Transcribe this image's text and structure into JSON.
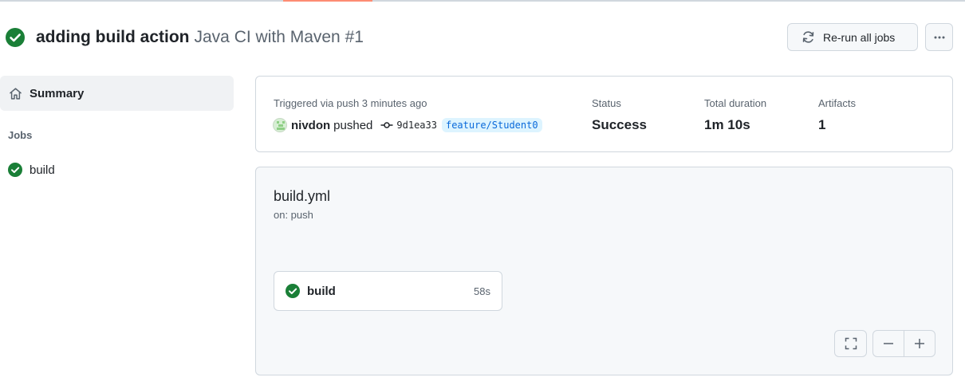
{
  "run": {
    "title": "adding build action",
    "workflow_label": "Java CI with Maven #1",
    "status_icon": "check-circle-fill-icon"
  },
  "actions": {
    "rerun_label": "Re-run all jobs",
    "rerun_icon": "sync-icon",
    "more_icon": "kebab-horizontal-icon"
  },
  "sidebar": {
    "summary_label": "Summary",
    "summary_icon": "home-icon",
    "jobs_heading": "Jobs",
    "jobs": [
      {
        "label": "build",
        "status": "success"
      }
    ]
  },
  "summary_card": {
    "triggered_text": "Triggered via push 3 minutes ago",
    "actor": "nivdon",
    "event": "pushed",
    "commit_sha": "9d1ea33",
    "branch": "feature/Student0",
    "status_label": "Status",
    "status_value": "Success",
    "duration_label": "Total duration",
    "duration_value": "1m 10s",
    "artifacts_label": "Artifacts",
    "artifacts_value": "1"
  },
  "graph": {
    "file_name": "build.yml",
    "trigger": "on: push",
    "jobs": [
      {
        "name": "build",
        "duration": "58s",
        "status": "success"
      }
    ],
    "controls": [
      "fullscreen-icon",
      "zoom-out-icon",
      "zoom-in-icon"
    ]
  },
  "colors": {
    "success": "#1a7f37",
    "accent_tab": "#fd8c73",
    "border": "#d0d7de",
    "muted_text": "#59636e",
    "branch_text": "#0969da",
    "branch_bg": "#ddf4ff"
  }
}
